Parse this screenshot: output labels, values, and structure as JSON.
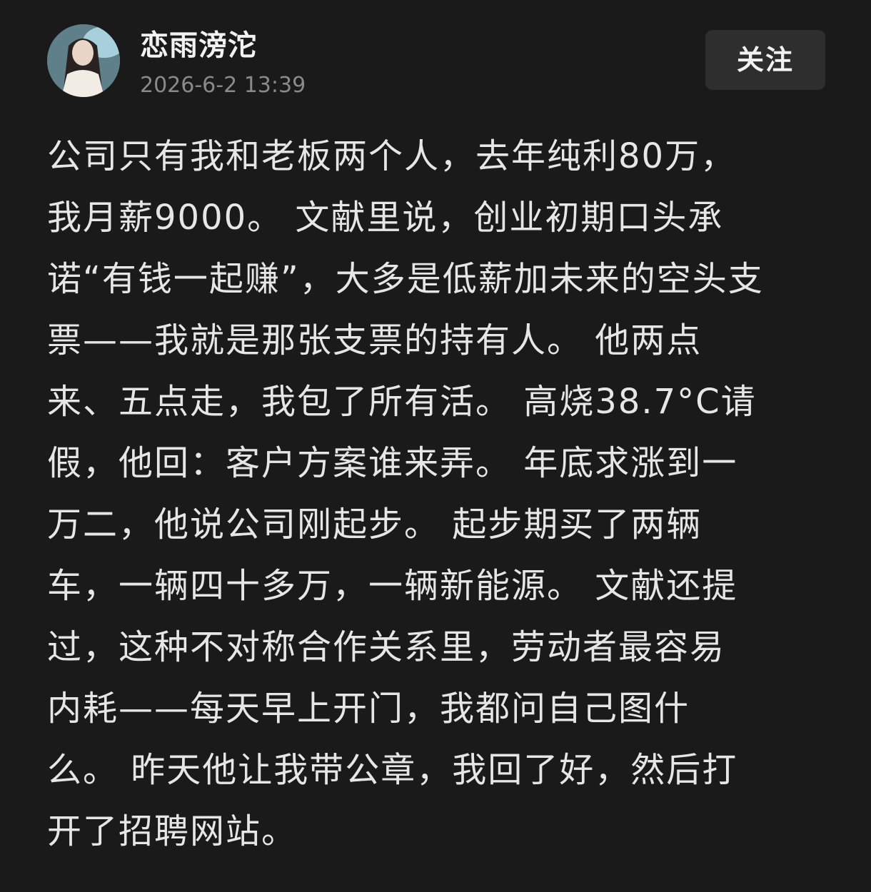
{
  "header": {
    "username": "恋雨滂沱",
    "timestamp": "2026-6-2 13:39",
    "follow_label": "关注"
  },
  "post": {
    "lines": [
      "公司只有我和老板两个人，去年纯利80万，",
      "我月薪9000。 文献里说，创业初期口头承",
      "诺“有钱一起赚”，大多是低薪加未来的空头支",
      "票——我就是那张支票的持有人。 他两点",
      "来、五点走，我包了所有活。 高烧38.7°C请",
      "假，他回：客户方案谁来弄。 年底求涨到一",
      "万二，他说公司刚起步。 起步期买了两辆",
      "车，一辆四十多万，一辆新能源。 文献还提",
      "过，这种不对称合作关系里，劳动者最容易",
      "内耗——每天早上开门，我都问自己图什",
      "么。 昨天他让我带公章，我回了好，然后打",
      "开了招聘网站。"
    ]
  }
}
